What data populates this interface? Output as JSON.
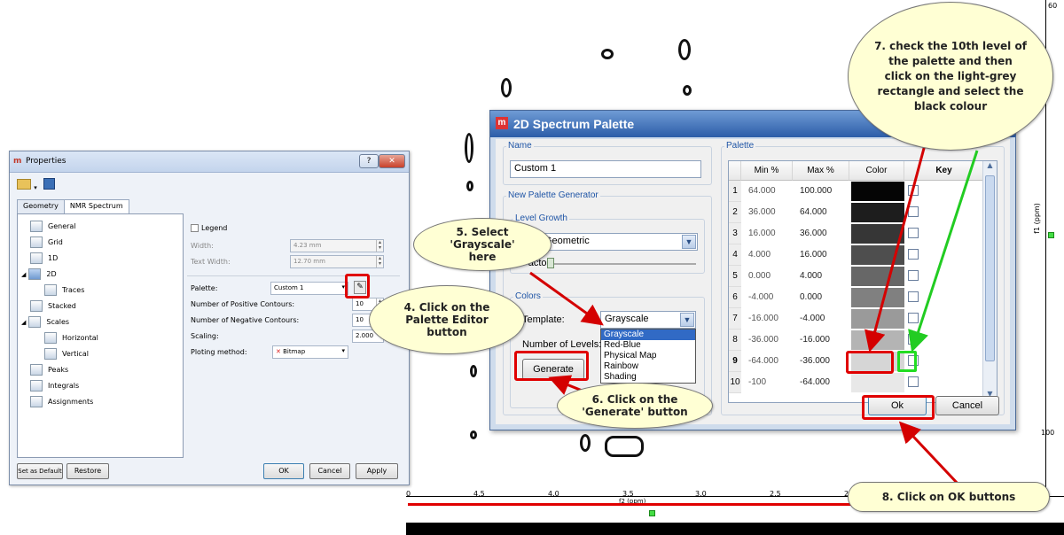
{
  "properties": {
    "title": "Properties",
    "tabs": [
      "Geometry",
      "NMR Spectrum"
    ],
    "tree": [
      "General",
      "Grid",
      "1D",
      "2D",
      "Traces",
      "Stacked",
      "Scales",
      "Horizontal",
      "Vertical",
      "Peaks",
      "Integrals",
      "Assignments"
    ],
    "legend_label": "Legend",
    "width_label": "Width:",
    "width_value": "4.23 mm",
    "text_width_label": "Text Width:",
    "text_width_value": "12.70 mm",
    "palette_label": "Palette:",
    "palette_value": "Custom 1",
    "pos_contours_label": "Number of Positive Contours:",
    "pos_contours_value": "10",
    "neg_contours_label": "Number of Negative Contours:",
    "neg_contours_value": "10",
    "scaling_label": "Scaling:",
    "scaling_value": "2.000",
    "plot_method_label": "Ploting method:",
    "plot_method_value": "Bitmap",
    "buttons": {
      "set_default": "Set as Default",
      "restore": "Restore",
      "ok": "OK",
      "cancel": "Cancel",
      "apply": "Apply"
    }
  },
  "palette_dialog": {
    "title": "2D Spectrum Palette",
    "name_group": "Name",
    "name_value": "Custom 1",
    "generator_group": "New Palette Generator",
    "growth_group": "Level Growth",
    "growth_value": "Geometric",
    "factor_label": "Factor:",
    "colors_group": "Colors",
    "template_label": "Template:",
    "template_value": "Grayscale",
    "template_options": [
      "Grayscale",
      "Red-Blue",
      "Physical Map",
      "Rainbow",
      "Shading"
    ],
    "levels_label": "Number of Levels:",
    "generate_label": "Generate",
    "palette_group": "Palette",
    "columns": [
      "Min %",
      "Max %",
      "Color",
      "Key"
    ],
    "rows": [
      {
        "n": "1",
        "min": "64.000",
        "max": "100.000",
        "color": "#050505"
      },
      {
        "n": "2",
        "min": "36.000",
        "max": "64.000",
        "color": "#1d1d1d"
      },
      {
        "n": "3",
        "min": "16.000",
        "max": "36.000",
        "color": "#363636"
      },
      {
        "n": "4",
        "min": "4.000",
        "max": "16.000",
        "color": "#4e4e4e"
      },
      {
        "n": "5",
        "min": "0.000",
        "max": "4.000",
        "color": "#676767"
      },
      {
        "n": "6",
        "min": "-4.000",
        "max": "0.000",
        "color": "#808080"
      },
      {
        "n": "7",
        "min": "-16.000",
        "max": "-4.000",
        "color": "#9a9a9a"
      },
      {
        "n": "8",
        "min": "-36.000",
        "max": "-16.000",
        "color": "#b4b4b4"
      },
      {
        "n": "9",
        "min": "-64.000",
        "max": "-36.000",
        "color": "#d6d6d6"
      },
      {
        "n": "10",
        "min": "-100",
        "max": "-64.000",
        "color": "#e8e8e8"
      }
    ],
    "ok_label": "Ok",
    "cancel_label": "Cancel"
  },
  "spectrum": {
    "x_ticks": [
      "4.5",
      "4.0",
      "3.5",
      "3.0",
      "2.5"
    ],
    "x_label": "f2 (ppm)",
    "y_label": "f1 (ppm)",
    "y_ticks": [
      "60",
      "100"
    ],
    "x_edge": "0",
    "x_edge_right": "2"
  },
  "callouts": {
    "c4": "4. Click on the Palette Editor button",
    "c5": "5. Select 'Grayscale' here",
    "c6": "6. Click on the 'Generate' button",
    "c7": "7. check the 10th level of the palette and then click on the light-grey rectangle and select the black colour",
    "c8": "8. Click on OK buttons"
  },
  "colors": {
    "highlight_red": "#e00000",
    "highlight_green": "#22dd22",
    "callout_fill": "#ffffd4",
    "title_blue": "#2c5da8"
  }
}
